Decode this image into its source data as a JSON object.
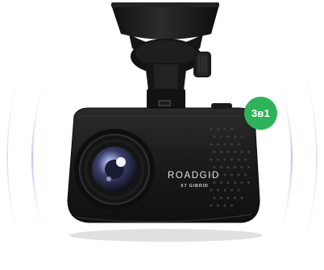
{
  "product": {
    "brand": "ROADGID",
    "model": "X7 GIBRID",
    "badge": "3в1"
  },
  "colors": {
    "badge": "#2fb35a",
    "body": "#1c1c1c",
    "ring": "#c7c9f2",
    "background": "#ffffff"
  }
}
